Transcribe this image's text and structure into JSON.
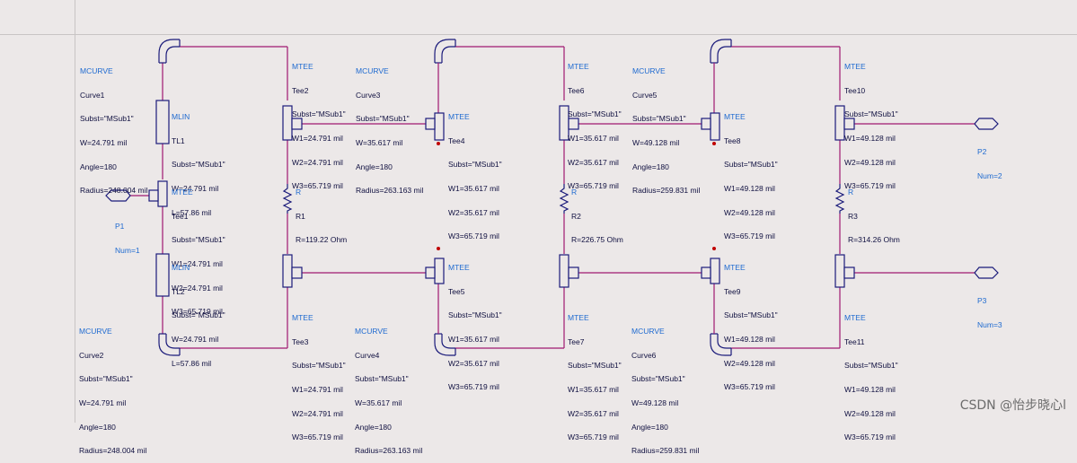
{
  "watermark": "CSDN @怡步晓心l",
  "components": {
    "curve1": [
      "MCURVE",
      "Curve1",
      "Subst=\"MSub1\"",
      "W=24.791 mil",
      "Angle=180",
      "Radius=248.004 mil"
    ],
    "tl1": [
      "MLIN",
      "TL1",
      "Subst=\"MSub1\"",
      "W=24.791 mil",
      "L=57.86 mil"
    ],
    "tee1": [
      "MTEE",
      "Tee1",
      "Subst=\"MSub1\"",
      "W1=24.791 mil",
      "W2=24.791 mil",
      "W3=65.719 mil"
    ],
    "p1": [
      "P1",
      "Num=1"
    ],
    "tl2": [
      "MLIN",
      "TL2",
      "Subst=\"MSub1\"",
      "W=24.791 mil",
      "L=57.86 mil"
    ],
    "curve2": [
      "MCURVE",
      "Curve2",
      "Subst=\"MSub1\"",
      "W=24.791 mil",
      "Angle=180",
      "Radius=248.004 mil"
    ],
    "tee2": [
      "MTEE",
      "Tee2",
      "Subst=\"MSub1\"",
      "W1=24.791 mil",
      "W2=24.791 mil",
      "W3=65.719 mil"
    ],
    "r1": [
      "R",
      "R1",
      "R=119.22 Ohm"
    ],
    "tee3": [
      "MTEE",
      "Tee3",
      "Subst=\"MSub1\"",
      "W1=24.791 mil",
      "W2=24.791 mil",
      "W3=65.719 mil"
    ],
    "curve3": [
      "MCURVE",
      "Curve3",
      "Subst=\"MSub1\"",
      "W=35.617 mil",
      "Angle=180",
      "Radius=263.163 mil"
    ],
    "tee4": [
      "MTEE",
      "Tee4",
      "Subst=\"MSub1\"",
      "W1=35.617 mil",
      "W2=35.617 mil",
      "W3=65.719 mil"
    ],
    "tee5": [
      "MTEE",
      "Tee5",
      "Subst=\"MSub1\"",
      "W1=35.617 mil",
      "W2=35.617 mil",
      "W3=65.719 mil"
    ],
    "curve4": [
      "MCURVE",
      "Curve4",
      "Subst=\"MSub1\"",
      "W=35.617 mil",
      "Angle=180",
      "Radius=263.163 mil"
    ],
    "tee6": [
      "MTEE",
      "Tee6",
      "Subst=\"MSub1\"",
      "W1=35.617 mil",
      "W2=35.617 mil",
      "W3=65.719 mil"
    ],
    "r2": [
      "R",
      "R2",
      "R=226.75 Ohm"
    ],
    "tee7": [
      "MTEE",
      "Tee7",
      "Subst=\"MSub1\"",
      "W1=35.617 mil",
      "W2=35.617 mil",
      "W3=65.719 mil"
    ],
    "curve5": [
      "MCURVE",
      "Curve5",
      "Subst=\"MSub1\"",
      "W=49.128 mil",
      "Angle=180",
      "Radius=259.831 mil"
    ],
    "tee8": [
      "MTEE",
      "Tee8",
      "Subst=\"MSub1\"",
      "W1=49.128 mil",
      "W2=49.128 mil",
      "W3=65.719 mil"
    ],
    "tee9": [
      "MTEE",
      "Tee9",
      "Subst=\"MSub1\"",
      "W1=49.128 mil",
      "W2=49.128 mil",
      "W3=65.719 mil"
    ],
    "curve6": [
      "MCURVE",
      "Curve6",
      "Subst=\"MSub1\"",
      "W=49.128 mil",
      "Angle=180",
      "Radius=259.831 mil"
    ],
    "tee10": [
      "MTEE",
      "Tee10",
      "Subst=\"MSub1\"",
      "W1=49.128 mil",
      "W2=49.128 mil",
      "W3=65.719 mil"
    ],
    "r3": [
      "R",
      "R3",
      "R=314.26 Ohm"
    ],
    "tee11": [
      "MTEE",
      "Tee11",
      "Subst=\"MSub1\"",
      "W1=49.128 mil",
      "W2=49.128 mil",
      "W3=65.719 mil"
    ],
    "p2": [
      "P2",
      "Num=2"
    ],
    "p3": [
      "P3",
      "Num=3"
    ]
  }
}
